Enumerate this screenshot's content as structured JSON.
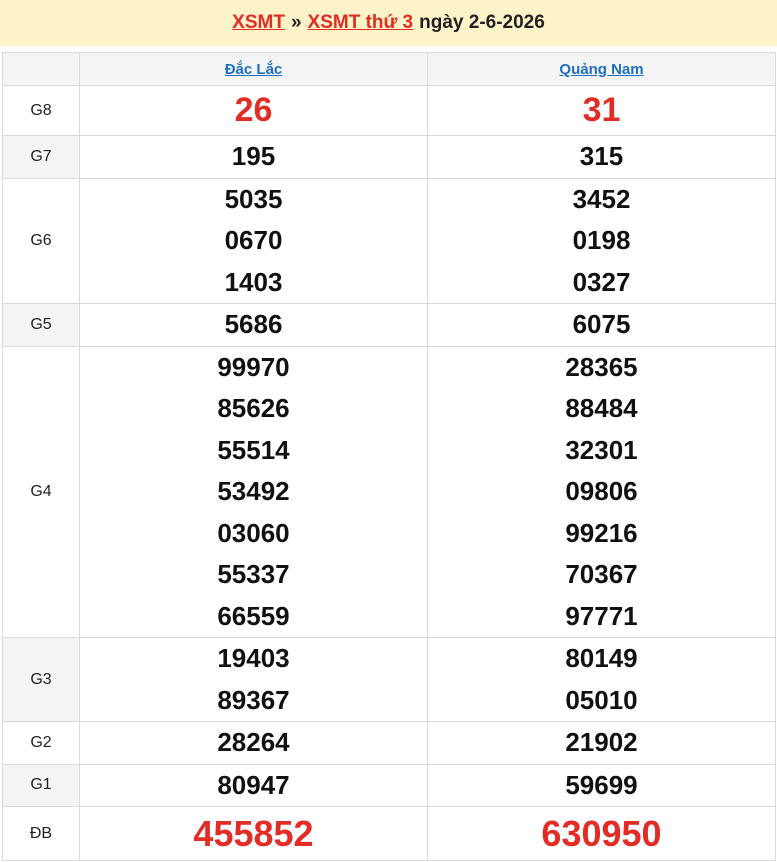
{
  "header": {
    "link1": "XSMT",
    "separator": "»",
    "link2": "XSMT thứ 3",
    "date": "ngày 2-6-2026"
  },
  "provinces": [
    "Đắc Lắc",
    "Quảng Nam"
  ],
  "prizes": [
    {
      "label": "G8",
      "values": [
        [
          "26"
        ],
        [
          "31"
        ]
      ]
    },
    {
      "label": "G7",
      "values": [
        [
          "195"
        ],
        [
          "315"
        ]
      ]
    },
    {
      "label": "G6",
      "values": [
        [
          "5035",
          "0670",
          "1403"
        ],
        [
          "3452",
          "0198",
          "0327"
        ]
      ]
    },
    {
      "label": "G5",
      "values": [
        [
          "5686"
        ],
        [
          "6075"
        ]
      ]
    },
    {
      "label": "G4",
      "values": [
        [
          "99970",
          "85626",
          "55514",
          "53492",
          "03060",
          "55337",
          "66559"
        ],
        [
          "28365",
          "88484",
          "32301",
          "09806",
          "99216",
          "70367",
          "97771"
        ]
      ]
    },
    {
      "label": "G3",
      "values": [
        [
          "19403",
          "89367"
        ],
        [
          "80149",
          "05010"
        ]
      ]
    },
    {
      "label": "G2",
      "values": [
        [
          "28264"
        ],
        [
          "21902"
        ]
      ]
    },
    {
      "label": "G1",
      "values": [
        [
          "80947"
        ],
        [
          "59699"
        ]
      ]
    },
    {
      "label": "ĐB",
      "values": [
        [
          "455852"
        ],
        [
          "630950"
        ]
      ]
    }
  ],
  "colors": {
    "accent_red": "#e22c26",
    "header_bg": "#fdf3c8",
    "link_blue": "#1f6fbf"
  }
}
